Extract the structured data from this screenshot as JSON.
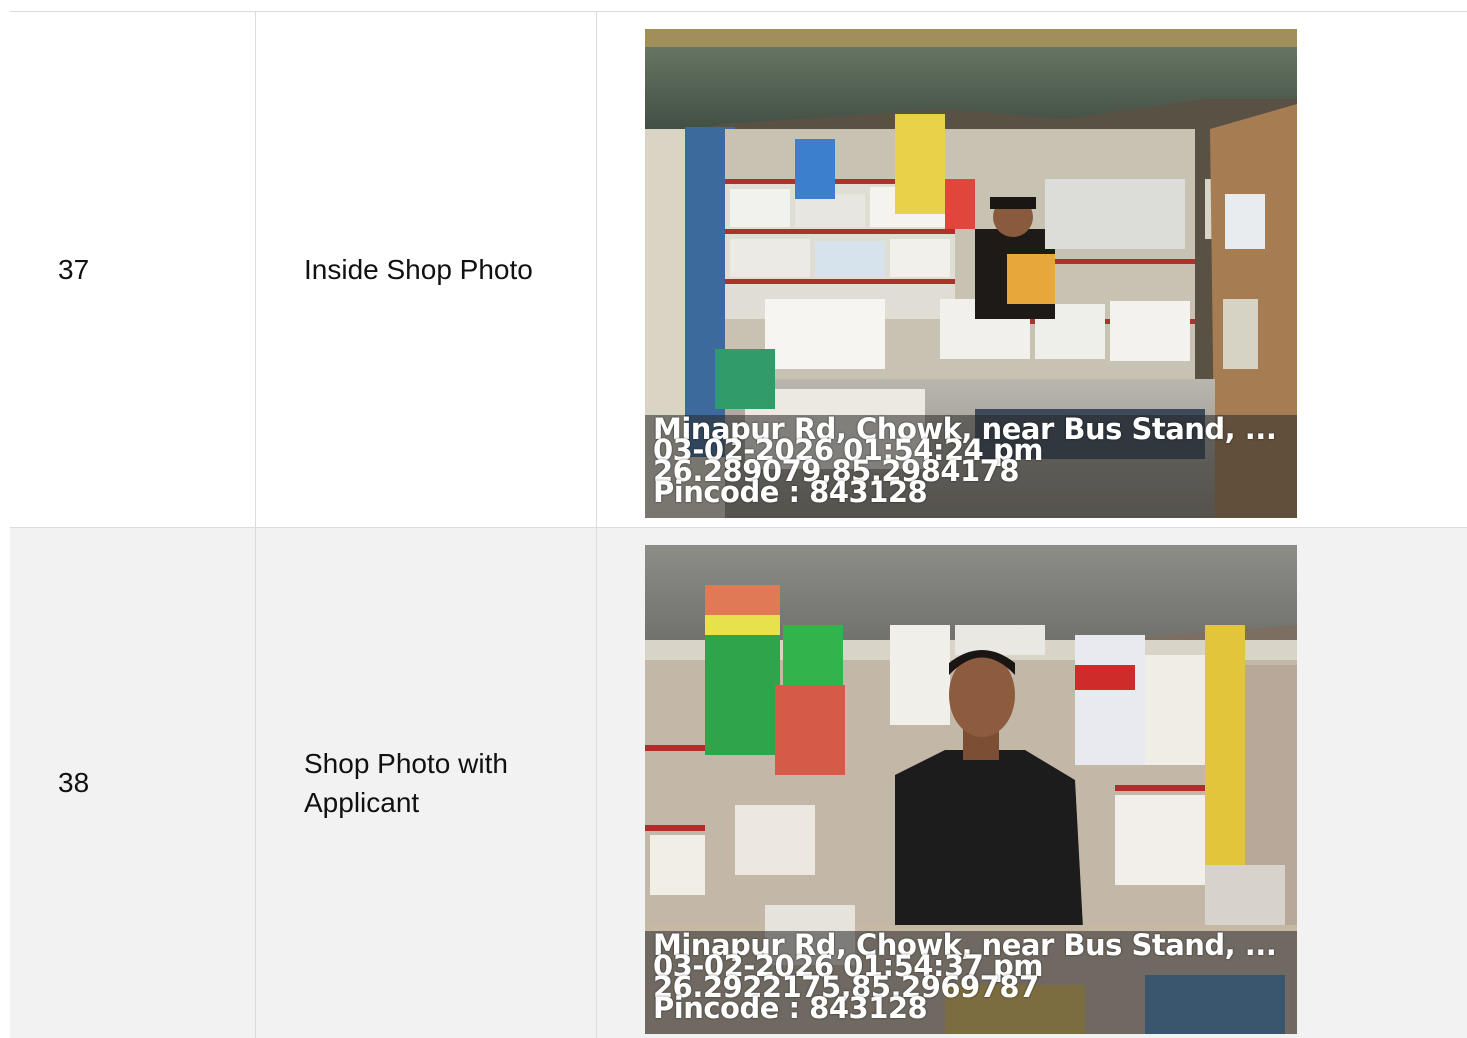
{
  "rows": [
    {
      "number": "37",
      "label": "Inside Shop Photo",
      "photo": {
        "address": "Minapur Rd, Chowk, near Bus Stand, ...",
        "datetime": "03-02-2026 01:54:24 pm",
        "coords": "26.289079,85.2984178",
        "pincode": "Pincode : 843128"
      }
    },
    {
      "number": "38",
      "label": "Shop Photo with Applicant",
      "photo": {
        "address": "Minapur Rd, Chowk, near Bus Stand, ...",
        "datetime": "03-02-2026 01:54:37 pm",
        "coords": "26.2922175,85.2969787",
        "pincode": "Pincode : 843128"
      }
    }
  ],
  "colors": {
    "border": "#dcdcdc",
    "row_alt_bg": "#f2f2f2",
    "overlay_text": "#ffffff"
  }
}
